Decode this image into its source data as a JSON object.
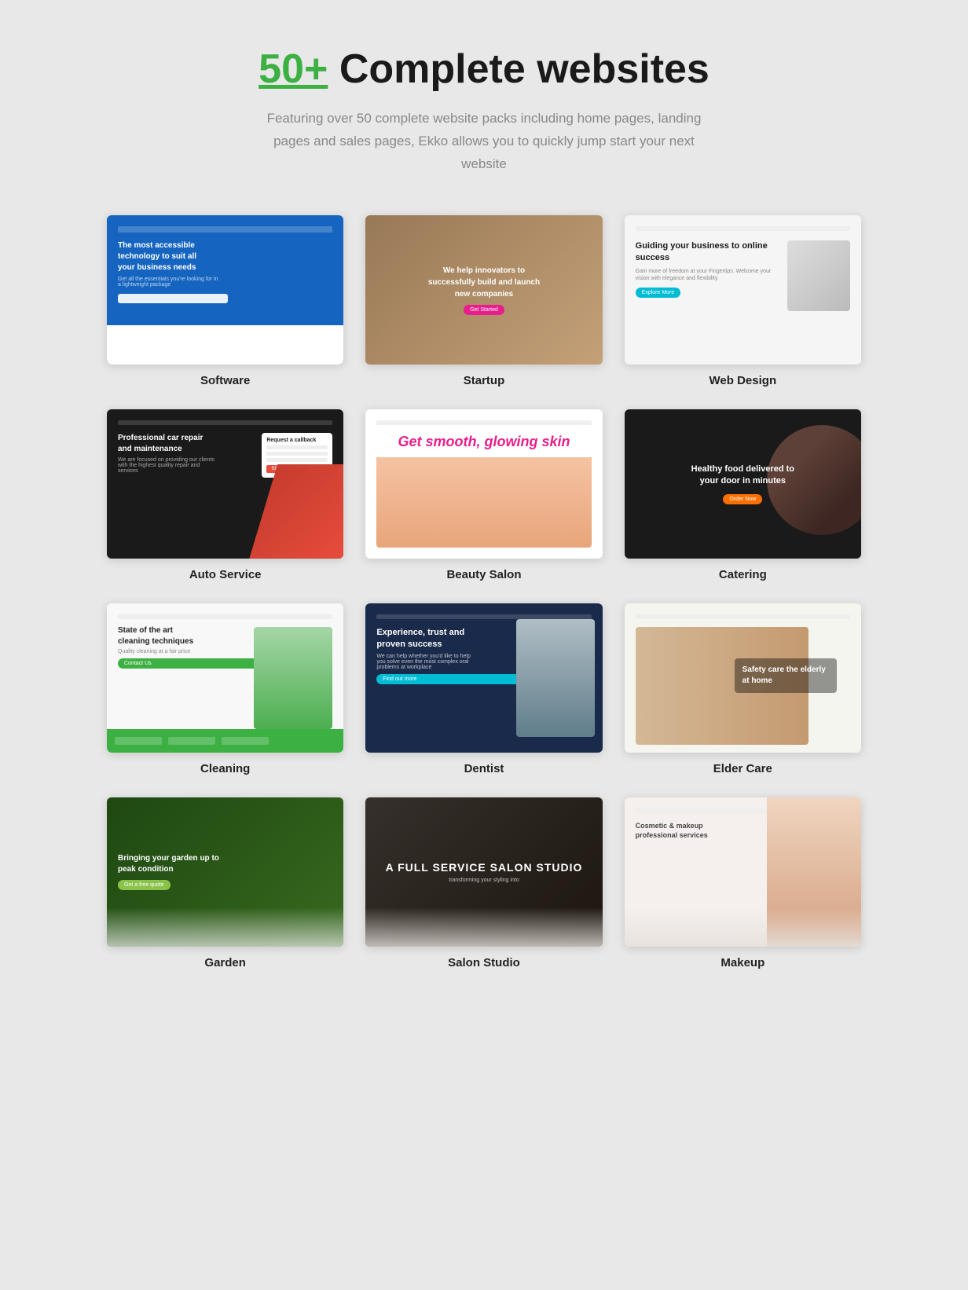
{
  "header": {
    "title_highlight": "50+",
    "title_rest": " Complete websites",
    "description": "Featuring over 50 complete website packs including home pages, landing pages and sales pages, Ekko allows you to quickly jump start your next website"
  },
  "cards": [
    {
      "id": "software",
      "label": "Software",
      "headline": "The most accessible technology to suit all your business needs"
    },
    {
      "id": "startup",
      "label": "Startup",
      "headline": "We help innovators to successfully build and launch new companies"
    },
    {
      "id": "webdesign",
      "label": "Web Design",
      "headline": "Guiding your business to online success"
    },
    {
      "id": "autoservice",
      "label": "Auto Service",
      "headline": "Professional car repair and maintenance"
    },
    {
      "id": "beautysalon",
      "label": "Beauty Salon",
      "headline": "Get smooth, glowing skin"
    },
    {
      "id": "catering",
      "label": "Catering",
      "headline": "Healthy food delivered to your door in minutes"
    },
    {
      "id": "cleaning",
      "label": "Cleaning",
      "headline": "State of the art cleaning techniques"
    },
    {
      "id": "dentist",
      "label": "Dentist",
      "headline": "Experience, trust and proven success"
    },
    {
      "id": "eldercare",
      "label": "Elder Care",
      "headline": "Safety care the elderly at home"
    },
    {
      "id": "garden",
      "label": "Garden",
      "headline": "Bringing your garden up to peak condition"
    },
    {
      "id": "salon",
      "label": "Salon Studio",
      "headline": "A Full Service Salon Studio"
    },
    {
      "id": "makeup",
      "label": "Makeup",
      "headline": "Cosmetic & makeup professional services"
    }
  ]
}
